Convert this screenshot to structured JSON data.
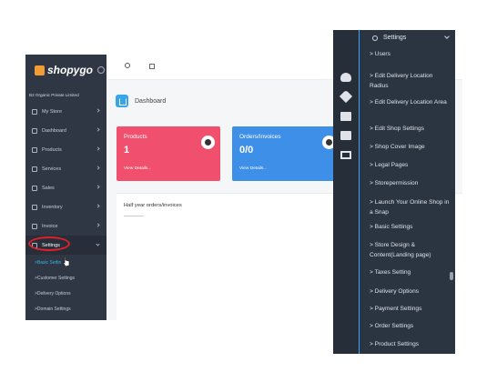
{
  "left_app": {
    "logo": "shopygo",
    "company": "B2 Organic Private Limited",
    "menu": [
      {
        "label": "My Store"
      },
      {
        "label": "Dashboard"
      },
      {
        "label": "Products"
      },
      {
        "label": "Services"
      },
      {
        "label": "Sales"
      },
      {
        "label": "Inventory"
      },
      {
        "label": "Invoice"
      },
      {
        "label": "Settings",
        "active": true
      }
    ],
    "submenu": [
      "Basic Settin",
      "Customer Settings",
      "Delivery Options",
      "Domain Settings"
    ],
    "page_title": "Dashboard",
    "cards": [
      {
        "label": "Products",
        "value": "1",
        "link": "View Details...",
        "color": "#f0506e"
      },
      {
        "label": "Orders/Invoices",
        "value": "0/0",
        "link": "View Details...",
        "color": "#3d8fe8"
      }
    ],
    "chart_title": "Half year orders/invoices"
  },
  "right_app": {
    "header": "Settings",
    "rail_icons": [
      "cloud-icon",
      "heart-icon",
      "folder-icon",
      "mail-icon",
      "monitor-icon"
    ],
    "items": [
      "Users",
      "Edit Delivery Location Radius",
      "Edit Delivery Location Area",
      "Edit Shop Settings",
      "Shop Cover Image",
      "Legal Pages",
      "Storepermission",
      "Launch Your Online Shop in a Snap",
      "Basic Settings",
      "Store Design & Content(Landing page)",
      "Taxes Setting",
      "Delivery Options",
      "Payment Settings",
      "Order Settings",
      "Product Settings"
    ]
  }
}
